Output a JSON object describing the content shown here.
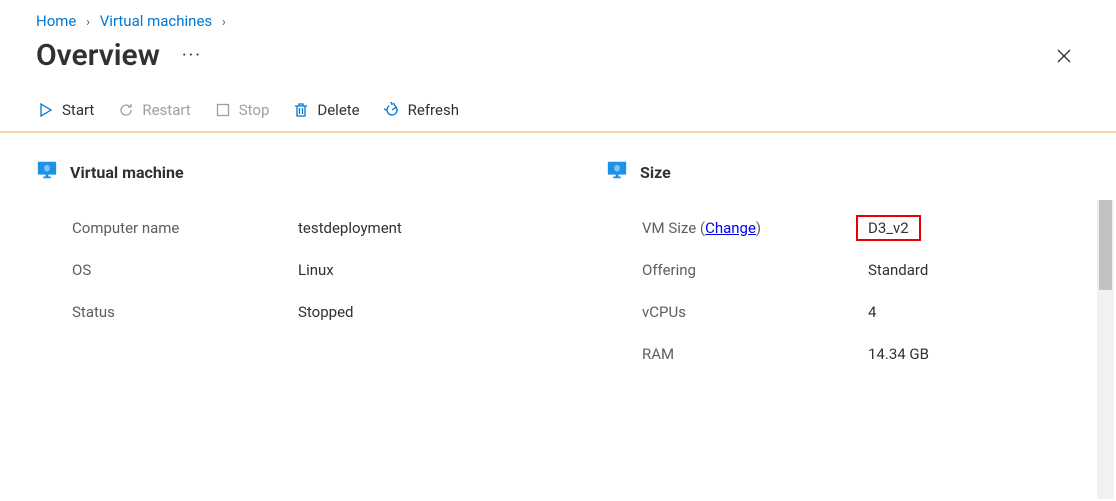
{
  "breadcrumb": {
    "home": "Home",
    "vms": "Virtual machines"
  },
  "header": {
    "title": "Overview",
    "more": "···"
  },
  "toolbar": {
    "start": "Start",
    "restart": "Restart",
    "stop": "Stop",
    "delete": "Delete",
    "refresh": "Refresh"
  },
  "sections": {
    "vm": {
      "title": "Virtual machine",
      "kv": {
        "computer_name_label": "Computer name",
        "computer_name_value": "testdeployment",
        "os_label": "OS",
        "os_value": "Linux",
        "status_label": "Status",
        "status_value": "Stopped"
      }
    },
    "size": {
      "title": "Size",
      "kv": {
        "vmsize_label": "VM Size (",
        "vmsize_change": "Change",
        "vmsize_label_close": ")",
        "vmsize_value": "D3_v2",
        "offering_label": "Offering",
        "offering_value": "Standard",
        "vcpus_label": "vCPUs",
        "vcpus_value": "4",
        "ram_label": "RAM",
        "ram_value": "14.34 GB"
      }
    }
  }
}
